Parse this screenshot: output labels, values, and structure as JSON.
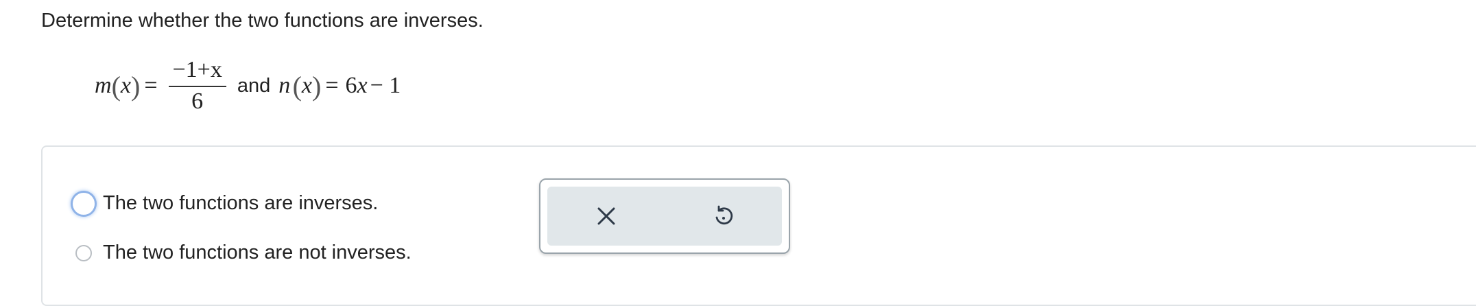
{
  "question": {
    "prompt": "Determine whether the two functions are inverses."
  },
  "expression": {
    "m_name": "m",
    "m_var": "x",
    "m_numerator": "−1+x",
    "m_denominator": "6",
    "connector": "and",
    "n_name": "n",
    "n_var": "x",
    "n_rhs_coef": "6",
    "n_rhs_var": "x",
    "n_rhs_tail": "− 1"
  },
  "options": [
    {
      "label": "The two functions are inverses.",
      "selected": false,
      "focused": true
    },
    {
      "label": "The two functions are not inverses.",
      "selected": false,
      "focused": false
    }
  ],
  "actions": {
    "clear_icon": "close-icon",
    "undo_icon": "undo-icon"
  },
  "colors": {
    "focus_ring": "#8fb3e8",
    "panel_border": "#dfe3e6",
    "action_bg": "#e1e7ea",
    "icon": "#2e3a48"
  }
}
